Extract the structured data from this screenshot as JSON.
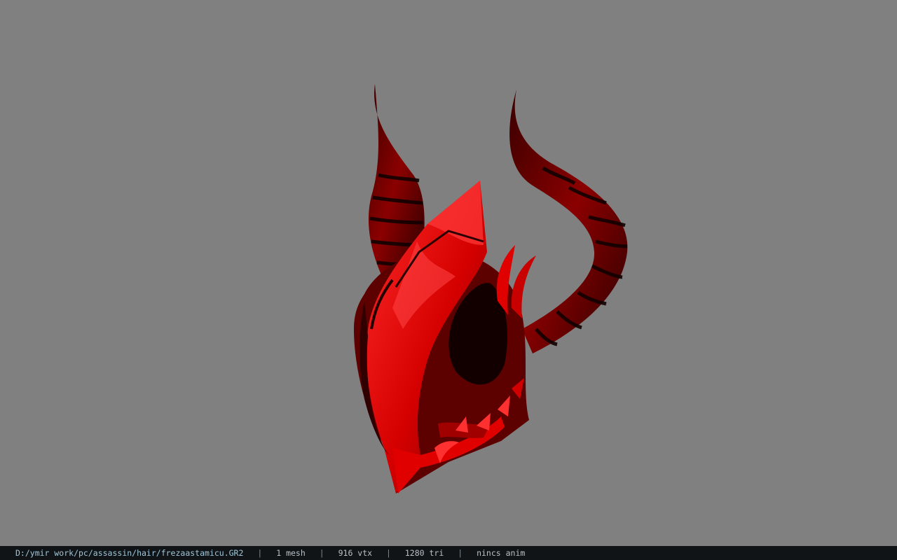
{
  "viewer": {
    "background_color": "#808080",
    "model_icon": "horned-mask-icon",
    "model_colors": {
      "primary": "#e00000",
      "highlight": "#ff3a3a",
      "shadow": "#4a0000",
      "dark": "#120000"
    }
  },
  "status_bar": {
    "file_path": "D:/ymir work/pc/assassin/hair/frezaastamicu.GR2",
    "separator": "|",
    "mesh_count": "1 mesh",
    "vertex_count": "916 vtx",
    "triangle_count": "1280 tri",
    "animation": "nincs anim"
  }
}
